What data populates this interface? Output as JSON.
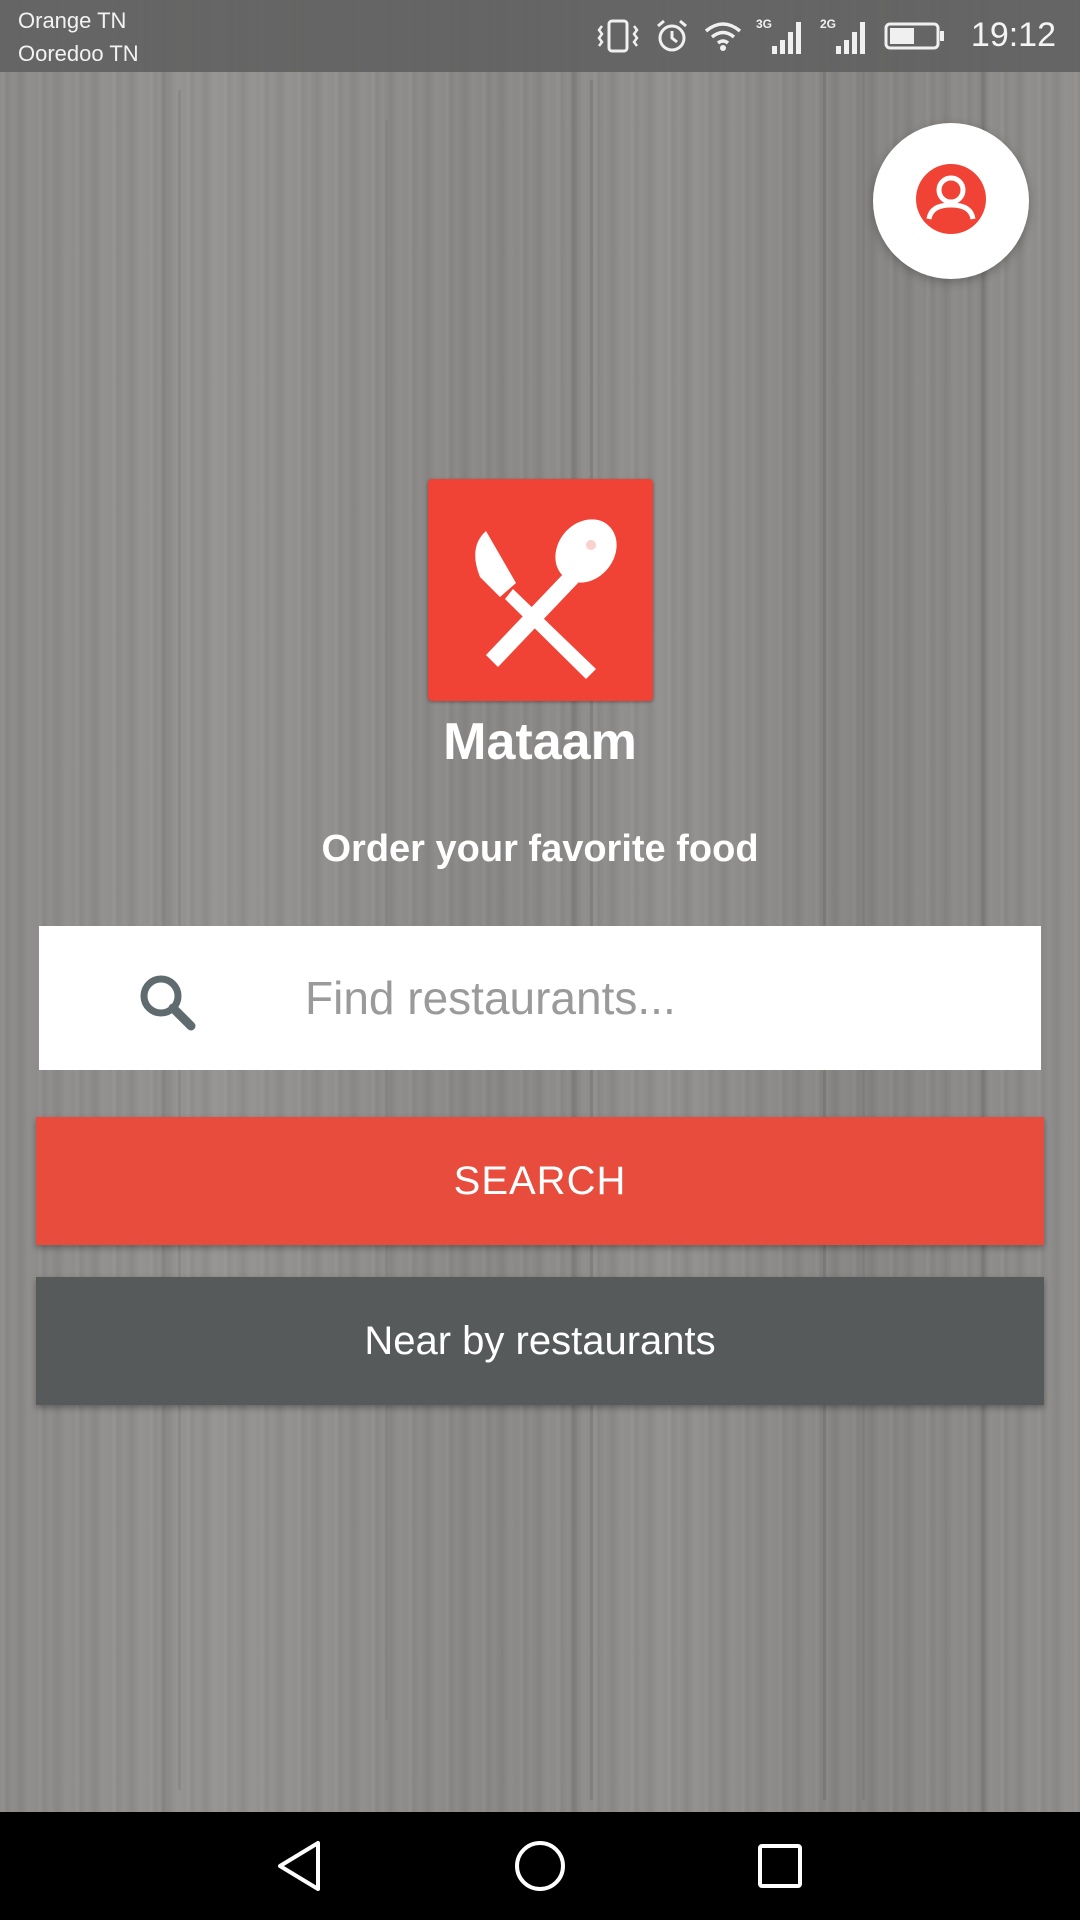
{
  "status_bar": {
    "carrier_1": "Orange TN",
    "carrier_2": "Ooredoo TN",
    "network_1": "3G",
    "network_2": "2G",
    "time": "19:12",
    "icons": [
      "vibrate-icon",
      "alarm-icon",
      "wifi-icon",
      "signal-3g-icon",
      "signal-2g-icon",
      "battery-icon"
    ]
  },
  "profile": {
    "icon": "user-account-icon",
    "accent_color": "#f04336"
  },
  "app": {
    "logo_icon": "knife-spoon-icon",
    "name": "Mataam",
    "tagline": "Order your favorite food"
  },
  "search": {
    "icon": "search-icon",
    "placeholder": "Find restaurants...",
    "value": ""
  },
  "buttons": {
    "search_label": "SEARCH",
    "nearby_label": "Near by restaurants"
  },
  "colors": {
    "brand_red": "#f04336",
    "search_button": "#e74c3c",
    "nearby_button": "#575a5b"
  },
  "nav_bar": {
    "icons": [
      "back-icon",
      "home-icon",
      "recents-icon"
    ]
  }
}
